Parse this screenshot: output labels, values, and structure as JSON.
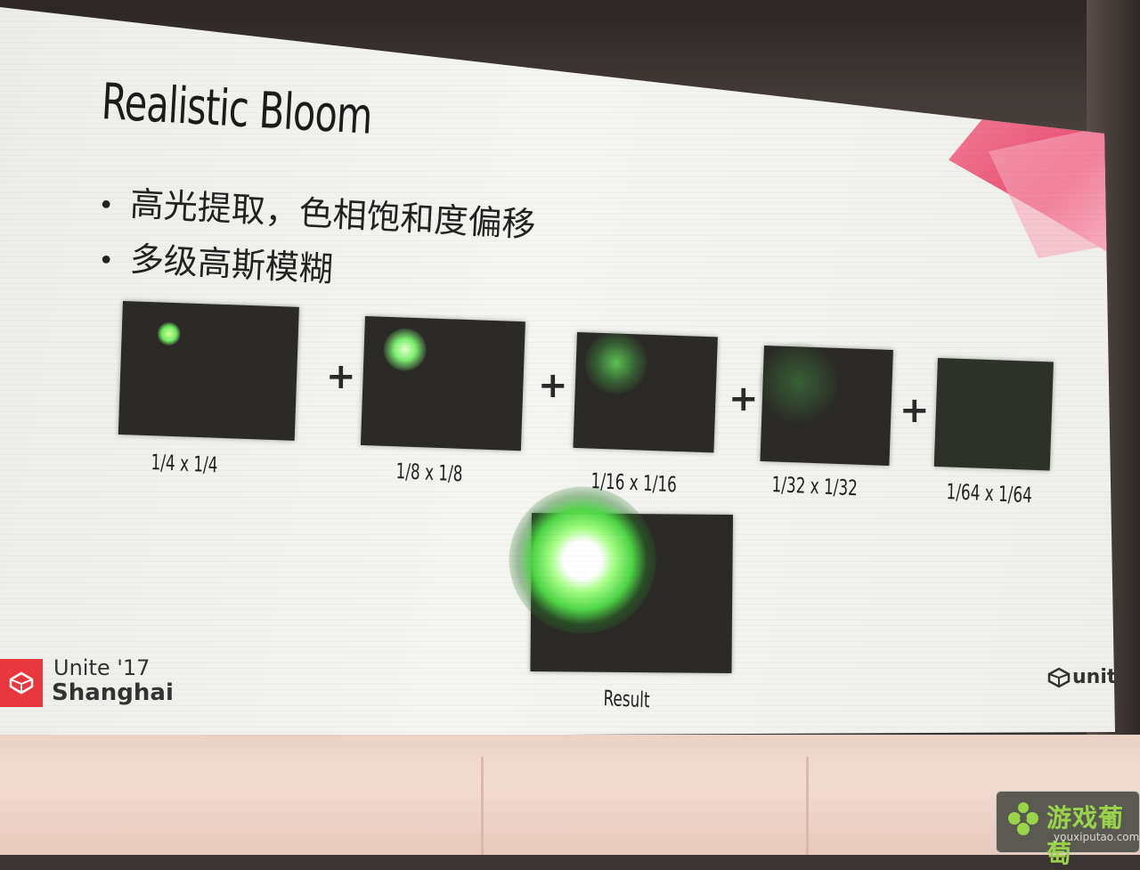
{
  "slide": {
    "title": "Realistic Bloom",
    "bullets": [
      "高光提取，色相饱和度偏移",
      "多级高斯模糊"
    ],
    "plus_sign": "+",
    "thumbnails": [
      {
        "label": "1/4 x 1/4"
      },
      {
        "label": "1/8 x 1/8"
      },
      {
        "label": "1/16 x 1/16"
      },
      {
        "label": "1/32 x 1/32"
      },
      {
        "label": "1/64 x 1/64"
      }
    ],
    "result_label": "Result",
    "event": {
      "name": "Unite '17",
      "city": "Shanghai"
    },
    "unity_logo_text": "unity"
  },
  "watermark": {
    "name": "游戏葡萄",
    "url": "youxiputao.com"
  },
  "colors": {
    "bloom_green": "#6ee860",
    "accent_red": "#e8305a",
    "unite_red": "#e8383d"
  }
}
